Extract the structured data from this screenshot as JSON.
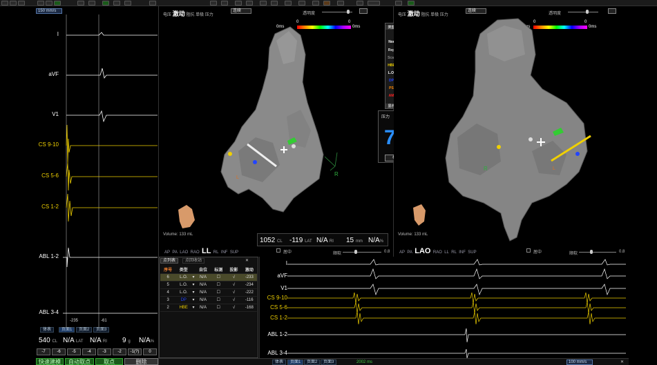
{
  "top_bar": {
    "buttons": 26
  },
  "left_panel": {
    "speed": "150 mm/s",
    "channels": [
      {
        "label": "I",
        "color": "#ffffff"
      },
      {
        "label": "aVF",
        "color": "#ffffff"
      },
      {
        "label": "V1",
        "color": "#ffffff"
      },
      {
        "label": "CS 9-10",
        "color": "#f0d000"
      },
      {
        "label": "CS 5-6",
        "color": "#f0d000"
      },
      {
        "label": "CS 1-2",
        "color": "#f0d000"
      },
      {
        "label": "ABL 1-2",
        "color": "#ffffff"
      },
      {
        "label": "ABL 3-4",
        "color": "#ffffff"
      }
    ],
    "marker_left": "-235",
    "marker_right": "-61",
    "tabs": [
      "体表",
      "页面1",
      "页面2",
      "页面3"
    ],
    "stats": {
      "cl": "540",
      "cl_unit": "CL",
      "lat": "N/A",
      "lat_unit": "LAT",
      "ri": "N/A",
      "ri_unit": "RI",
      "force": "9",
      "force_unit": "g",
      "pct": "N/A",
      "pct_unit": "%"
    },
    "offset_buttons": [
      "-7",
      "-6",
      "-5",
      "-4",
      "-3",
      "-2",
      "-1(?)",
      "0"
    ],
    "action_buttons": [
      "快速建模",
      "自动取点",
      "取点",
      "删除"
    ]
  },
  "view_left": {
    "tabs": [
      "电压",
      "激动",
      "阻抗",
      "单极",
      "压力"
    ],
    "active_tab": "激动",
    "dropdown": "连续",
    "opacity_label": "透明度",
    "scale_left": "0ms",
    "scale_right": "0ms",
    "scale_top_left": "0",
    "scale_top_right": "0",
    "orientation": "LL",
    "direction": "R",
    "volume": "Volume: 133 mL",
    "views": [
      "AP",
      "PA",
      "LAO",
      "RAO",
      "LL",
      "RL",
      "INF",
      "SUP"
    ],
    "checkbox_label": "居中",
    "smooth_label": "顺软",
    "smooth_value": "0.8",
    "readout": {
      "cl": "1052",
      "cl_unit": "CL",
      "lat": "-119",
      "lat_unit": "LAT",
      "ri": "N/A",
      "ri_unit": "RI",
      "dist": "15",
      "dist_unit": "mm",
      "pct": "N/A",
      "pct_unit": "%"
    }
  },
  "view_right": {
    "tabs": [
      "电压",
      "激动",
      "阻抗",
      "单极",
      "压力"
    ],
    "active_tab": "激动",
    "dropdown": "连续",
    "opacity_label": "透明度",
    "scale_left": "-0ms",
    "scale_right": "0ms",
    "scale_top_left": "0",
    "scale_top_right": "0",
    "orientation": "LAO",
    "direction": "R",
    "volume": "Volume: 133 mL",
    "views": [
      "AP",
      "PA",
      "LAO",
      "RAO",
      "LL",
      "RL",
      "INF",
      "SUP"
    ],
    "checkbox_label": "居中",
    "smooth_label": "顺软",
    "smooth_value": "0.8"
  },
  "type_panel": {
    "title": "类型",
    "items": [
      {
        "label": "Nor",
        "color": "#ffffff"
      },
      {
        "label": "Rep",
        "color": "#dddddd"
      },
      {
        "label": "Scar",
        "color": "#888888"
      },
      {
        "label": "HBE",
        "color": "#f0d000"
      },
      {
        "label": "L.O.",
        "color": "#ffffff"
      },
      {
        "label": "DP",
        "color": "#2244ff"
      },
      {
        "label": "PS",
        "color": "#ff8800"
      },
      {
        "label": "AM",
        "color": "#ff2222"
      }
    ],
    "show_label": "显示"
  },
  "force_panel": {
    "title": "压力",
    "value": "7",
    "unit": "g",
    "button": "校零"
  },
  "point_table": {
    "tabs": [
      "点列表",
      "点回收站"
    ],
    "headers": [
      "序号",
      "类型",
      "",
      "自位",
      "标测",
      "投影",
      "激动"
    ],
    "rows": [
      {
        "no": "6",
        "type": "L.O.",
        "val": "N/A",
        "act": "-233"
      },
      {
        "no": "5",
        "type": "L.O.",
        "val": "N/A",
        "act": "-234"
      },
      {
        "no": "4",
        "type": "L.O.",
        "val": "N/A",
        "act": "-222"
      },
      {
        "no": "3",
        "type": "DP",
        "val": "N/A",
        "act": "-116"
      },
      {
        "no": "2",
        "type": "HBE",
        "val": "N/A",
        "act": "-168"
      }
    ]
  },
  "egm_panel": {
    "channels": [
      {
        "label": "I",
        "color": "#ffffff"
      },
      {
        "label": "aVF",
        "color": "#ffffff"
      },
      {
        "label": "V1",
        "color": "#ffffff"
      },
      {
        "label": "CS 9-10",
        "color": "#f0d000"
      },
      {
        "label": "CS 5-6",
        "color": "#f0d000"
      },
      {
        "label": "CS 1-2",
        "color": "#f0d000"
      },
      {
        "label": "ABL 1-2",
        "color": "#ffffff"
      },
      {
        "label": "ABL 3-4",
        "color": "#ffffff"
      }
    ]
  },
  "bottom_bar": {
    "tabs": [
      "体表",
      "页面1",
      "页面2",
      "页面3"
    ],
    "timer": "2002 ms",
    "speed": "100 mm/s"
  }
}
